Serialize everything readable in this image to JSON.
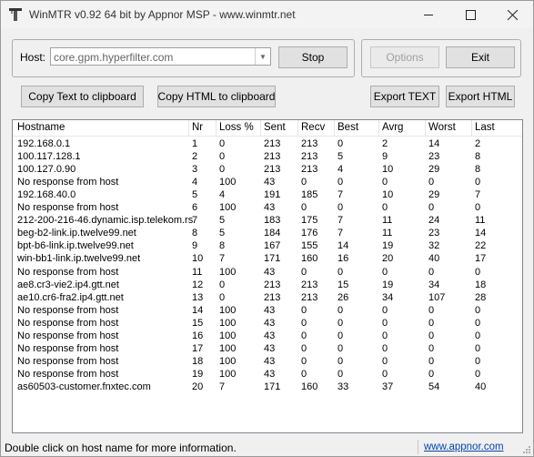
{
  "window": {
    "title": "WinMTR v0.92 64 bit by Appnor MSP - www.winmtr.net"
  },
  "host": {
    "label": "Host:",
    "value": "core.gpm.hyperfilter.com"
  },
  "buttons": {
    "stop": "Stop",
    "options": "Options",
    "exit": "Exit",
    "copy_text": "Copy Text to clipboard",
    "copy_html": "Copy HTML to clipboard",
    "export_text": "Export TEXT",
    "export_html": "Export HTML"
  },
  "table": {
    "columns": [
      "Hostname",
      "Nr",
      "Loss %",
      "Sent",
      "Recv",
      "Best",
      "Avrg",
      "Worst",
      "Last"
    ],
    "rows": [
      [
        "192.168.0.1",
        "1",
        "0",
        "213",
        "213",
        "0",
        "2",
        "14",
        "2"
      ],
      [
        "100.117.128.1",
        "2",
        "0",
        "213",
        "213",
        "5",
        "9",
        "23",
        "8"
      ],
      [
        "100.127.0.90",
        "3",
        "0",
        "213",
        "213",
        "4",
        "10",
        "29",
        "8"
      ],
      [
        "No response from host",
        "4",
        "100",
        "43",
        "0",
        "0",
        "0",
        "0",
        "0"
      ],
      [
        "192.168.40.0",
        "5",
        "4",
        "191",
        "185",
        "7",
        "10",
        "29",
        "7"
      ],
      [
        "No response from host",
        "6",
        "100",
        "43",
        "0",
        "0",
        "0",
        "0",
        "0"
      ],
      [
        "212-200-216-46.dynamic.isp.telekom.rs",
        "7",
        "5",
        "183",
        "175",
        "7",
        "11",
        "24",
        "11"
      ],
      [
        "beg-b2-link.ip.twelve99.net",
        "8",
        "5",
        "184",
        "176",
        "7",
        "11",
        "23",
        "14"
      ],
      [
        "bpt-b6-link.ip.twelve99.net",
        "9",
        "8",
        "167",
        "155",
        "14",
        "19",
        "32",
        "22"
      ],
      [
        "win-bb1-link.ip.twelve99.net",
        "10",
        "7",
        "171",
        "160",
        "16",
        "20",
        "40",
        "17"
      ],
      [
        "No response from host",
        "11",
        "100",
        "43",
        "0",
        "0",
        "0",
        "0",
        "0"
      ],
      [
        "ae8.cr3-vie2.ip4.gtt.net",
        "12",
        "0",
        "213",
        "213",
        "15",
        "19",
        "34",
        "18"
      ],
      [
        "ae10.cr6-fra2.ip4.gtt.net",
        "13",
        "0",
        "213",
        "213",
        "26",
        "34",
        "107",
        "28"
      ],
      [
        "No response from host",
        "14",
        "100",
        "43",
        "0",
        "0",
        "0",
        "0",
        "0"
      ],
      [
        "No response from host",
        "15",
        "100",
        "43",
        "0",
        "0",
        "0",
        "0",
        "0"
      ],
      [
        "No response from host",
        "16",
        "100",
        "43",
        "0",
        "0",
        "0",
        "0",
        "0"
      ],
      [
        "No response from host",
        "17",
        "100",
        "43",
        "0",
        "0",
        "0",
        "0",
        "0"
      ],
      [
        "No response from host",
        "18",
        "100",
        "43",
        "0",
        "0",
        "0",
        "0",
        "0"
      ],
      [
        "No response from host",
        "19",
        "100",
        "43",
        "0",
        "0",
        "0",
        "0",
        "0"
      ],
      [
        "as60503-customer.fnxtec.com",
        "20",
        "7",
        "171",
        "160",
        "33",
        "37",
        "54",
        "40"
      ]
    ]
  },
  "status": {
    "text": "Double click on host name for more information.",
    "link": "www.appnor.com"
  }
}
